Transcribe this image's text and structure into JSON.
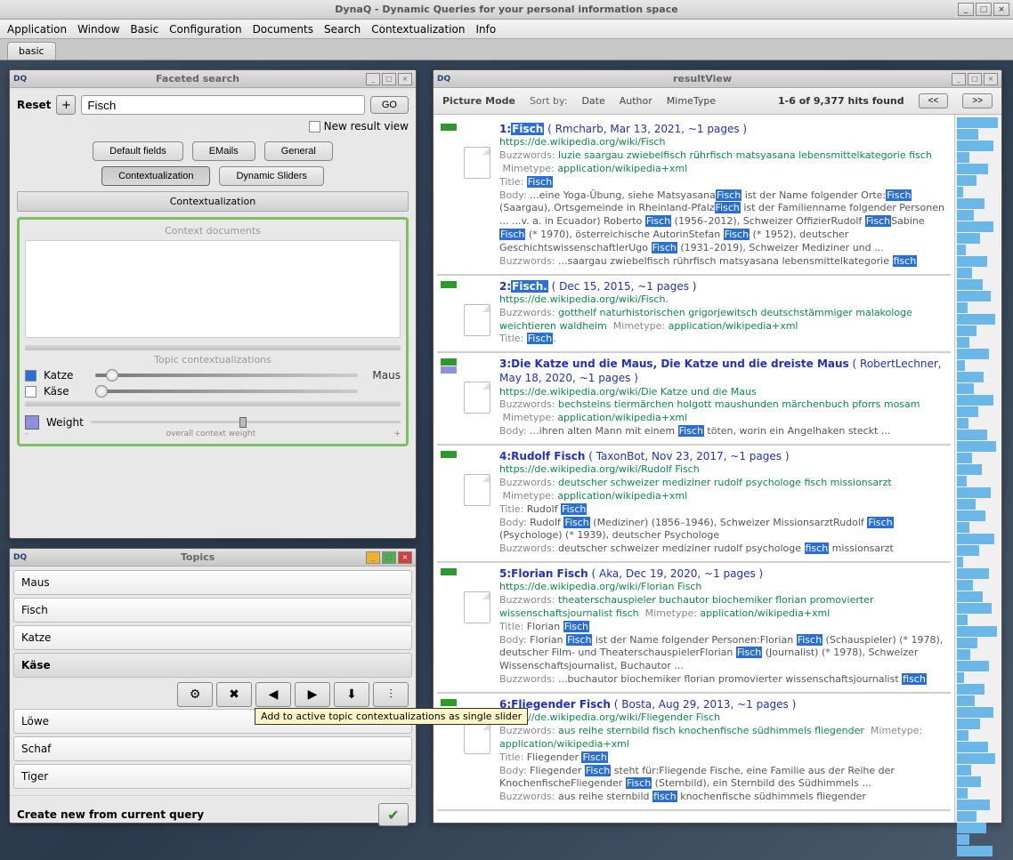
{
  "app": {
    "title": "DynaQ - Dynamic Queries for your personal information space",
    "menus": [
      "Application",
      "Window",
      "Basic",
      "Configuration",
      "Documents",
      "Search",
      "Contextualization",
      "Info"
    ],
    "tab": "basic"
  },
  "faceted": {
    "title": "Faceted search",
    "reset": "Reset",
    "plus": "+",
    "search_value": "Fisch",
    "go": "GO",
    "new_result_view": "New result view",
    "btn_default": "Default fields",
    "btn_emails": "EMails",
    "btn_general": "General",
    "btn_contextualization": "Contextualization",
    "btn_dynamic_sliders": "Dynamic Sliders",
    "section": "Contextualization",
    "context_documents": "Context documents",
    "topic_contextualizations": "Topic contextualizations",
    "slider1": {
      "left": "Katze",
      "right": "Maus",
      "checked": true
    },
    "slider2": {
      "left": "Käse",
      "right": "",
      "checked": false
    },
    "weight_label": "Weight",
    "overall": "overall context weight",
    "minus": "-",
    "plusw": "+"
  },
  "topics": {
    "title": "Topics",
    "items": [
      "Maus",
      "Fisch",
      "Katze",
      "Käse",
      "Löwe",
      "Schaf",
      "Tiger"
    ],
    "selected": "Käse",
    "footer": "Create new from current query",
    "tooltip": "Add to active topic contextualizations as single slider"
  },
  "resultview": {
    "title": "resultView",
    "picture_mode": "Picture Mode",
    "sort_by": "Sort by:",
    "sort_cols": [
      "Date",
      "Author",
      "MimeType"
    ],
    "hits": "1-6 of 9,377 hits found",
    "prev": "<<",
    "next": ">>"
  },
  "results": [
    {
      "title_pre": "1:",
      "title_hl": "Fisch",
      "meta": " ( Rmcharb, Mar 13, 2021, ~1 pages )",
      "url": "https://de.wikipedia.org/wiki/Fisch",
      "buzz": "luzie saargau zwiebelfisch rührfisch matsyasana lebensmittelkategorie fisch",
      "mimetype": "application/wikipedia+xml",
      "title_line": {
        "pre": "",
        "hl": "Fisch",
        "post": ""
      },
      "body": "...eine Yoga-Übung, siehe Matsyasana|Fisch| ist der Name folgender Orte:|Fisch| (Saargau), Ortsgemeinde in Rheinland-Pfalz|Fisch| ist der Familienname folgender Personen ... ...v. a. in Ecuador) Roberto |Fisch| (1956–2012), Schweizer OffizierRudolf |Fisch|Sabine |Fisch| (* 1970), österreichische AutorinStefan |Fisch| (* 1952), deutscher GeschichtswissenschaftlerUgo |Fisch| (1931–2019), Schweizer Mediziner und ...",
      "buzz2": "...saargau zwiebelfisch rührfisch matsyasana lebensmittelkategorie |fisch|"
    },
    {
      "title_pre": "2:",
      "title_hl": "Fisch.",
      "meta": " ( Dec 15, 2015, ~1 pages )",
      "url": "https://de.wikipedia.org/wiki/Fisch.",
      "buzz": "gotthelf naturhistorischen grigorjewitsch deutschstämmiger malakologe weichtieren waldheim",
      "mimetype": "application/wikipedia+xml",
      "title_line": {
        "pre": "",
        "hl": "Fisch",
        "post": "."
      }
    },
    {
      "title_pre": "3:",
      "title_plain": "Die Katze und die Maus, Die Katze und die dreiste Maus",
      "meta": " ( RobertLechner, May 18, 2020, ~1 pages )",
      "url": "https://de.wikipedia.org/wiki/Die Katze und die Maus",
      "buzz": "bechsteins tiermärchen holgott maushunden märchenbuch pforrs mosam",
      "mimetype": "application/wikipedia+xml",
      "body": "...ihren alten Mann mit einem |Fisch| töten, worin ein Angelhaken steckt ...",
      "badge_extra": true
    },
    {
      "title_pre": "4:",
      "title_plain": "Rudolf Fisch",
      "meta": " ( TaxonBot, Nov 23, 2017, ~1 pages )",
      "url": "https://de.wikipedia.org/wiki/Rudolf Fisch",
      "buzz": "deutscher schweizer mediziner rudolf psychologe fisch missionsarzt",
      "mimetype": "application/wikipedia+xml",
      "title_line": {
        "pre": "Rudolf ",
        "hl": "Fisch",
        "post": ""
      },
      "body": "Rudolf |Fisch| (Mediziner) (1856–1946), Schweizer MissionsarztRudolf |Fisch| (Psychologe) (* 1939), deutscher Psychologe",
      "buzz2": "deutscher schweizer mediziner rudolf psychologe |fisch| missionsarzt"
    },
    {
      "title_pre": "5:",
      "title_plain": "Florian Fisch",
      "meta": " ( Aka, Dec 19, 2020, ~1 pages )",
      "url": "https://de.wikipedia.org/wiki/Florian Fisch",
      "buzz": "theaterschauspieler buchautor biochemiker florian promovierter wissenschaftsjournalist fisch",
      "mimetype": "application/wikipedia+xml",
      "title_line": {
        "pre": "Florian ",
        "hl": "Fisch",
        "post": ""
      },
      "body": "Florian |Fisch| ist der Name folgender Personen:Florian |Fisch| (Schauspieler) (* 1978), deutscher Film- und TheaterschauspielerFlorian |Fisch| (Journalist) (* 1978), Schweizer Wissenschaftsjournalist, Buchautor ...",
      "buzz2": "...buchautor biochemiker florian promovierter wissenschaftsjournalist |fisch|"
    },
    {
      "title_pre": "6:",
      "title_plain": "Fliegender Fisch",
      "meta": " ( Bosta, Aug 29, 2013, ~1 pages )",
      "url": "https://de.wikipedia.org/wiki/Fliegender Fisch",
      "buzz": "aus reihe sternbild fisch knochenfische südhimmels fliegender",
      "mimetype": "application/wikipedia+xml",
      "title_line": {
        "pre": "Fliegender ",
        "hl": "Fisch",
        "post": ""
      },
      "body": "Fliegender |Fisch| steht für:Fliegende Fische, eine Familie aus der Reihe der KnochenfischeFliegender |Fisch| (Sternbild), ein Sternbild des Südhimmels ...",
      "buzz2": "aus reihe sternbild |fisch| knochenfische südhimmels fliegender"
    }
  ],
  "histogram": [
    95,
    50,
    85,
    30,
    72,
    45,
    15,
    65,
    40,
    85,
    55,
    20,
    70,
    35,
    60,
    80,
    25,
    90,
    45,
    30,
    75,
    18,
    62,
    40,
    85,
    50,
    28,
    70,
    92,
    36,
    58,
    22,
    80,
    44,
    66,
    30,
    88,
    52,
    14,
    74,
    38,
    60,
    82,
    26,
    94,
    48,
    32,
    76,
    16,
    64,
    42,
    86,
    54,
    28,
    72,
    90,
    34,
    56,
    24,
    78,
    46,
    68,
    30,
    84
  ]
}
